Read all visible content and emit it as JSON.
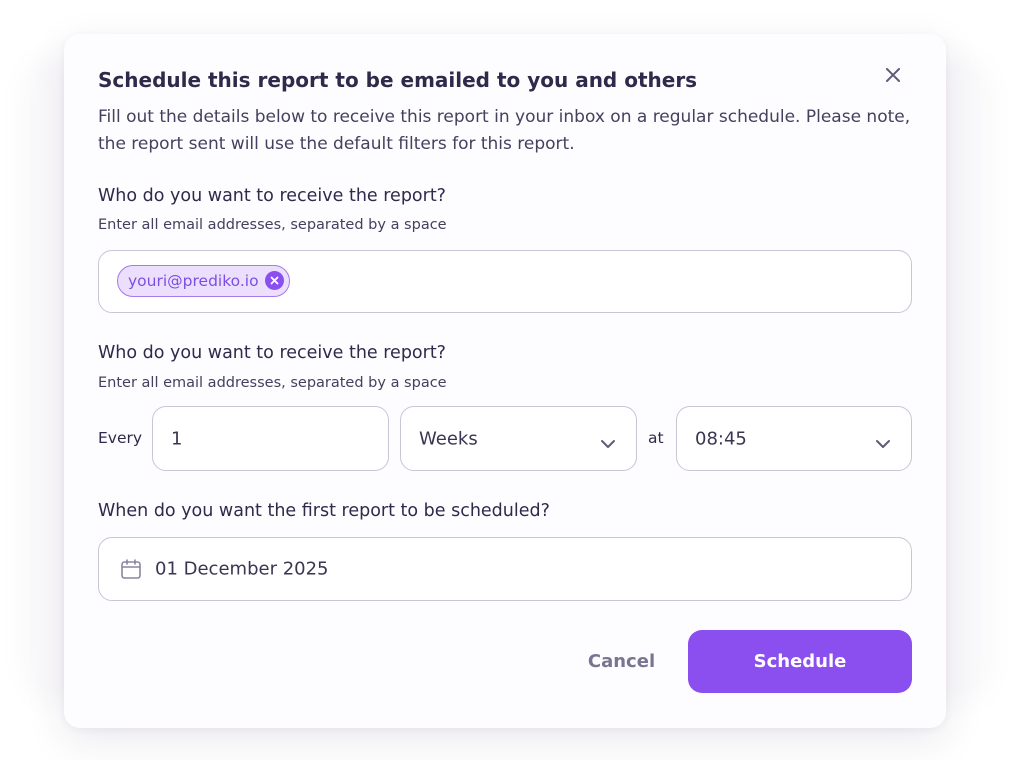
{
  "dialog": {
    "title": "Schedule this report to be emailed to you and others",
    "description": "Fill out the details below to receive this report in your inbox on a regular schedule. Please note, the report sent will use the default filters for this report.",
    "close_icon": "close-icon"
  },
  "recipients": {
    "label": "Who do you want to receive the report?",
    "hint": "Enter all email addresses, separated by a space",
    "emails": [
      "youri@prediko.io"
    ],
    "chip_remove_icon": "remove-circle-icon"
  },
  "frequency": {
    "label": "Who do you want to receive the report?",
    "hint": "Enter all email addresses, separated by a space",
    "every_label": "Every",
    "interval_value": "1",
    "unit_value": "Weeks",
    "at_label": "at",
    "time_value": "08:45",
    "dropdown_icon": "chevron-down-icon"
  },
  "first_schedule": {
    "label": "When do you want the first report to be scheduled?",
    "date_value": "01 December 2025",
    "date_icon": "calendar-icon"
  },
  "actions": {
    "cancel_label": "Cancel",
    "schedule_label": "Schedule"
  },
  "colors": {
    "accent": "#8b4ff0",
    "chip_background": "#ecdffd",
    "chip_text": "#7c4fe0",
    "heading_text": "#2f2a4a",
    "field_border": "#c9c6d6"
  }
}
